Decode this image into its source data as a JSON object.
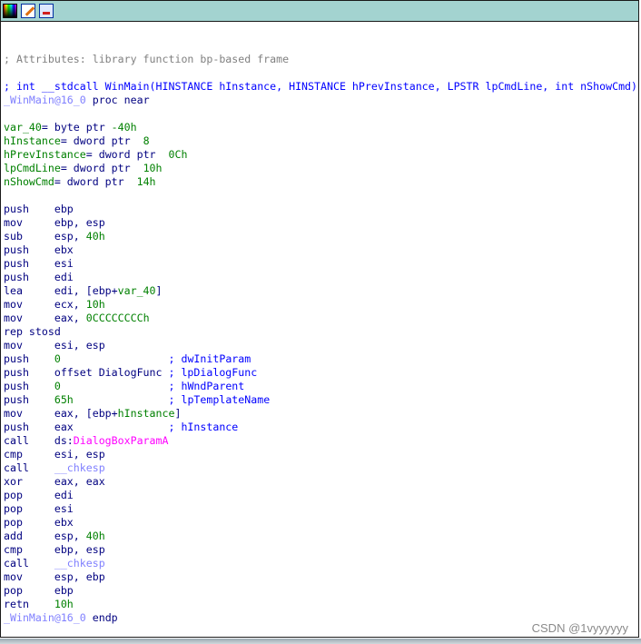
{
  "toolbar": {
    "icons": [
      "color-palette-icon",
      "edit-icon",
      "graph-view-icon"
    ]
  },
  "colors": {
    "title_bar": "#a3d3d0",
    "comment_gray": "#808080",
    "comment_blue": "#0000ff",
    "name": "#8080ff",
    "keyword": "#000080",
    "number": "#008000",
    "import": "#ff00ff"
  },
  "lines": [
    [
      [
        "; Attributes: library function bp-based frame",
        "gray"
      ]
    ],
    [],
    [
      [
        "; int __stdcall WinMain(HINSTANCE hInstance, HINSTANCE hPrevInstance, LPSTR lpCmdLine, int nShowCmd)",
        "blue"
      ]
    ],
    [
      [
        "_WinMain@16_0",
        "purple"
      ],
      [
        " proc near",
        "navy"
      ]
    ],
    [],
    [
      [
        "var_40",
        "green"
      ],
      [
        "= byte ptr ",
        "navy"
      ],
      [
        "-40h",
        "green"
      ]
    ],
    [
      [
        "hInstance",
        "green"
      ],
      [
        "= dword ptr  ",
        "navy"
      ],
      [
        "8",
        "green"
      ]
    ],
    [
      [
        "hPrevInstance",
        "green"
      ],
      [
        "= dword ptr  ",
        "navy"
      ],
      [
        "0Ch",
        "green"
      ]
    ],
    [
      [
        "lpCmdLine",
        "green"
      ],
      [
        "= dword ptr  ",
        "navy"
      ],
      [
        "10h",
        "green"
      ]
    ],
    [
      [
        "nShowCmd",
        "green"
      ],
      [
        "= dword ptr  ",
        "navy"
      ],
      [
        "14h",
        "green"
      ]
    ],
    [],
    [
      [
        "push    ebp",
        "navy"
      ]
    ],
    [
      [
        "mov     ebp, esp",
        "navy"
      ]
    ],
    [
      [
        "sub     esp, ",
        "navy"
      ],
      [
        "40h",
        "green"
      ]
    ],
    [
      [
        "push    ebx",
        "navy"
      ]
    ],
    [
      [
        "push    esi",
        "navy"
      ]
    ],
    [
      [
        "push    edi",
        "navy"
      ]
    ],
    [
      [
        "lea     edi, [ebp+",
        "navy"
      ],
      [
        "var_40",
        "green"
      ],
      [
        "]",
        "navy"
      ]
    ],
    [
      [
        "mov     ecx, ",
        "navy"
      ],
      [
        "10h",
        "green"
      ]
    ],
    [
      [
        "mov     eax, ",
        "navy"
      ],
      [
        "0CCCCCCCCh",
        "green"
      ]
    ],
    [
      [
        "rep stosd",
        "navy"
      ]
    ],
    [
      [
        "mov     esi, esp",
        "navy"
      ]
    ],
    [
      [
        "push    ",
        "navy"
      ],
      [
        "0",
        "green"
      ],
      [
        "                 ",
        "navy"
      ],
      [
        "; dwInitParam",
        "blue"
      ]
    ],
    [
      [
        "push    offset DialogFunc ",
        "navy"
      ],
      [
        "; lpDialogFunc",
        "blue"
      ]
    ],
    [
      [
        "push    ",
        "navy"
      ],
      [
        "0",
        "green"
      ],
      [
        "                 ",
        "navy"
      ],
      [
        "; hWndParent",
        "blue"
      ]
    ],
    [
      [
        "push    ",
        "navy"
      ],
      [
        "65h",
        "green"
      ],
      [
        "               ",
        "navy"
      ],
      [
        "; lpTemplateName",
        "blue"
      ]
    ],
    [
      [
        "mov     eax, [ebp+",
        "navy"
      ],
      [
        "hInstance",
        "green"
      ],
      [
        "]",
        "navy"
      ]
    ],
    [
      [
        "push    eax               ",
        "navy"
      ],
      [
        "; hInstance",
        "blue"
      ]
    ],
    [
      [
        "call    ds:",
        "navy"
      ],
      [
        "DialogBoxParamA",
        "magenta"
      ]
    ],
    [
      [
        "cmp     esi, esp",
        "navy"
      ]
    ],
    [
      [
        "call    ",
        "navy"
      ],
      [
        "__chkesp",
        "purple"
      ]
    ],
    [
      [
        "xor     eax, eax",
        "navy"
      ]
    ],
    [
      [
        "pop     edi",
        "navy"
      ]
    ],
    [
      [
        "pop     esi",
        "navy"
      ]
    ],
    [
      [
        "pop     ebx",
        "navy"
      ]
    ],
    [
      [
        "add     esp, ",
        "navy"
      ],
      [
        "40h",
        "green"
      ]
    ],
    [
      [
        "cmp     ebp, esp",
        "navy"
      ]
    ],
    [
      [
        "call    ",
        "navy"
      ],
      [
        "__chkesp",
        "purple"
      ]
    ],
    [
      [
        "mov     esp, ebp",
        "navy"
      ]
    ],
    [
      [
        "pop     ebp",
        "navy"
      ]
    ],
    [
      [
        "retn    ",
        "navy"
      ],
      [
        "10h",
        "green"
      ]
    ],
    [
      [
        "_WinMain@16_0",
        "purple"
      ],
      [
        " endp",
        "navy"
      ]
    ]
  ],
  "watermark": "CSDN @1vyyyyyy"
}
